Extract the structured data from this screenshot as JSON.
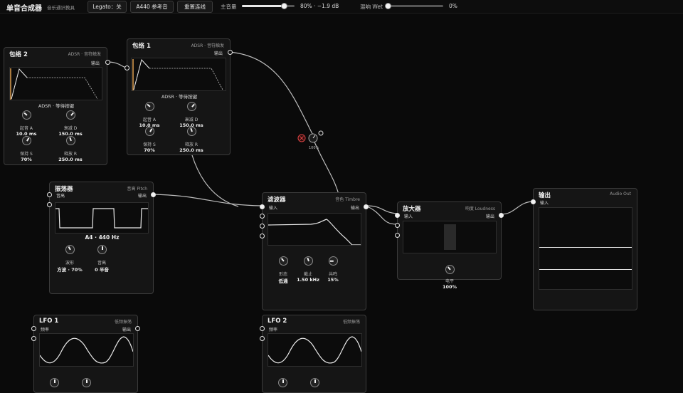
{
  "toolbar": {
    "title": "单音合成器",
    "subtitle": "音乐通识教具",
    "legato": "Legato：关",
    "a440": "A440 参考音",
    "reset": "重置连线",
    "master_label": "主音量",
    "master_value": "80% · −1.9 dB",
    "master_level": 0.8,
    "wet_label": "混响 Wet",
    "wet_value": "0%",
    "wet_level": 0.0
  },
  "env2": {
    "title": "包络 2",
    "subtitle": "ADSR · 音符触发",
    "out": "输出",
    "caption": "ADSR · 等待按键",
    "knobs": [
      {
        "label": "起音 A",
        "value": "10.0 ms"
      },
      {
        "label": "衰减 D",
        "value": "150.0 ms"
      },
      {
        "label": "保持 S",
        "value": "70%"
      },
      {
        "label": "释放 R",
        "value": "250.0 ms"
      }
    ]
  },
  "env1": {
    "title": "包络 1",
    "subtitle": "ADSR · 音符触发",
    "out": "输出",
    "caption": "ADSR · 等待按键",
    "knobs": [
      {
        "label": "起音 A",
        "value": "10.0 ms"
      },
      {
        "label": "衰减 D",
        "value": "150.0 ms"
      },
      {
        "label": "保持 S",
        "value": "70%"
      },
      {
        "label": "释放 R",
        "value": "250.0 ms"
      }
    ]
  },
  "mod_amount": "100%",
  "osc": {
    "title": "振荡器",
    "subtitle": "音高 Pitch",
    "in": "音高",
    "out": "输出",
    "caption": "A4 · 440 Hz",
    "knobs": [
      {
        "label": "波形",
        "value": "方波 · 70%"
      },
      {
        "label": "音高",
        "value": "0 半音"
      }
    ]
  },
  "filter": {
    "title": "滤波器",
    "subtitle": "音色 Timbre",
    "in": "输入",
    "out": "输出",
    "knobs": [
      {
        "label": "形态",
        "value": "低通"
      },
      {
        "label": "截止",
        "value": "1.50 kHz"
      },
      {
        "label": "共鸣",
        "value": "15%"
      }
    ]
  },
  "amp": {
    "title": "放大器",
    "subtitle": "响度 Loudness",
    "in": "输入",
    "out": "输出",
    "knob": {
      "label": "电平",
      "value": "100%"
    }
  },
  "output": {
    "title": "输出",
    "subtitle": "Audio Out",
    "in": "输入"
  },
  "lfo1": {
    "title": "LFO 1",
    "subtitle": "低频振荡",
    "in": "频率",
    "out": "输出"
  },
  "lfo2": {
    "title": "LFO 2",
    "subtitle": "低频振荡",
    "in": "频率"
  }
}
